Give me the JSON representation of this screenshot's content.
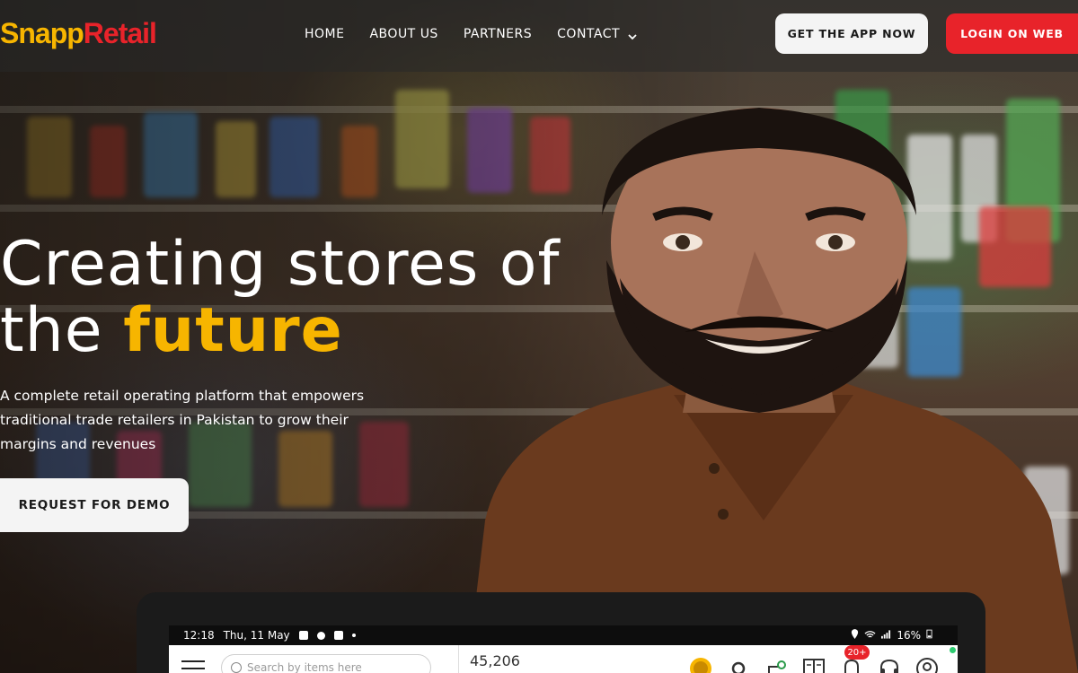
{
  "brand": {
    "part1": "Snapp",
    "part2": "Retail",
    "color_primary": "#f7b500",
    "color_secondary": "#e8232a"
  },
  "nav": {
    "items": [
      {
        "label": "HOME"
      },
      {
        "label": "ABOUT US"
      },
      {
        "label": "PARTNERS"
      },
      {
        "label": "CONTACT",
        "icon": "chevron-down-icon"
      }
    ]
  },
  "header": {
    "app_button": "GET THE APP NOW",
    "login_button": "LOGIN ON WEB"
  },
  "hero": {
    "title_line1": "Creating stores of",
    "title_line2_prefix": "the ",
    "title_accent": "future",
    "subtitle": "A complete retail operating platform that empowers traditional trade retailers in Pakistan to grow their margins and revenues",
    "demo_button": "REQUEST FOR DEMO"
  },
  "tablet": {
    "status": {
      "time": "12:18",
      "date": "Thu, 11 May",
      "battery": "16%"
    },
    "search_placeholder": "Search by items here",
    "amount": "45,206",
    "notification_badge": "20+",
    "icons": [
      "snapp-coin-icon",
      "location-pin-icon",
      "route-icon",
      "ledger-icon",
      "bell-icon",
      "headset-icon",
      "profile-icon"
    ]
  }
}
